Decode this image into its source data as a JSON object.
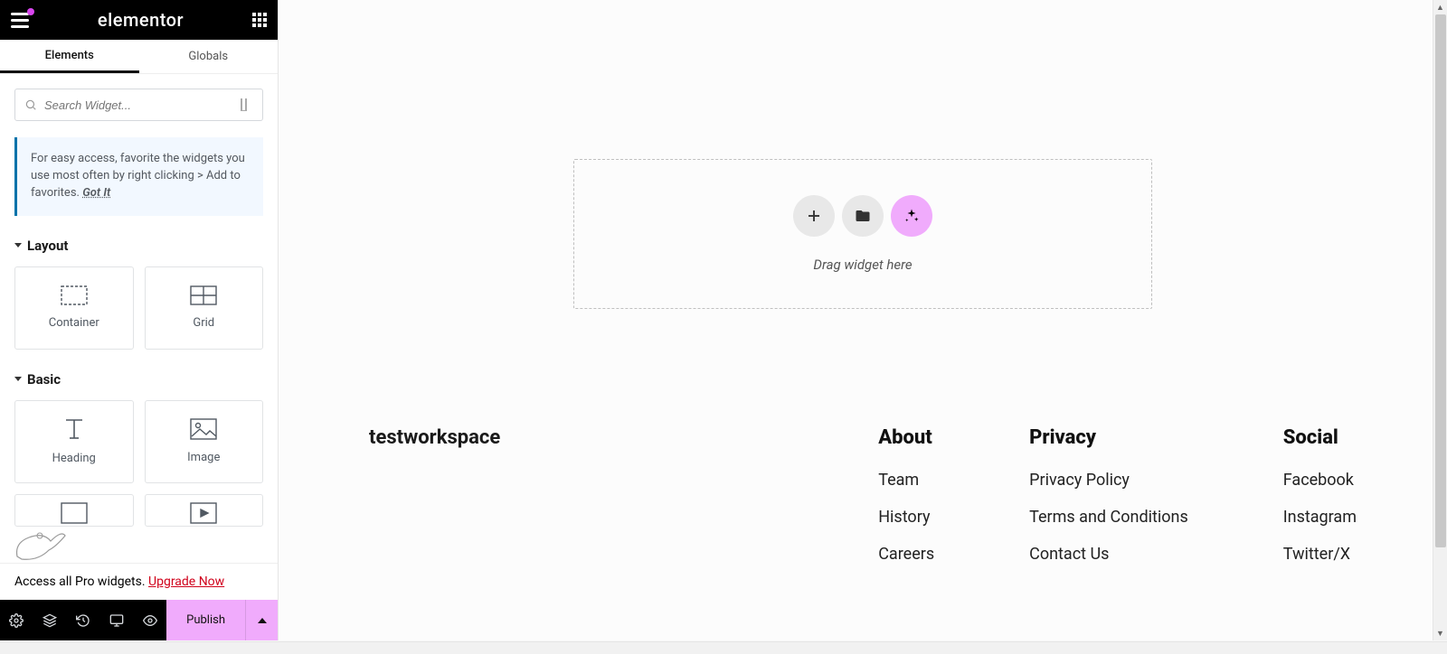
{
  "brand": "elementor",
  "tabs": {
    "elements": "Elements",
    "globals": "Globals"
  },
  "search": {
    "placeholder": "Search Widget..."
  },
  "tip": {
    "text": "For easy access, favorite the widgets you use most often by right clicking > Add to favorites.",
    "dismiss": "Got It"
  },
  "categories": {
    "layout": {
      "title": "Layout",
      "widgets": {
        "container": "Container",
        "grid": "Grid"
      }
    },
    "basic": {
      "title": "Basic",
      "widgets": {
        "heading": "Heading",
        "image": "Image"
      }
    }
  },
  "upgrade": {
    "text": "Access all Pro widgets. ",
    "link": "Upgrade Now"
  },
  "publish": "Publish",
  "dropzone": {
    "label": "Drag widget here"
  },
  "footer": {
    "workspace": "testworkspace",
    "about": {
      "title": "About",
      "items": [
        "Team",
        "History",
        "Careers"
      ]
    },
    "privacy": {
      "title": "Privacy",
      "items": [
        "Privacy Policy",
        "Terms and Conditions",
        "Contact Us"
      ]
    },
    "social": {
      "title": "Social",
      "items": [
        "Facebook",
        "Instagram",
        "Twitter/X"
      ]
    }
  }
}
